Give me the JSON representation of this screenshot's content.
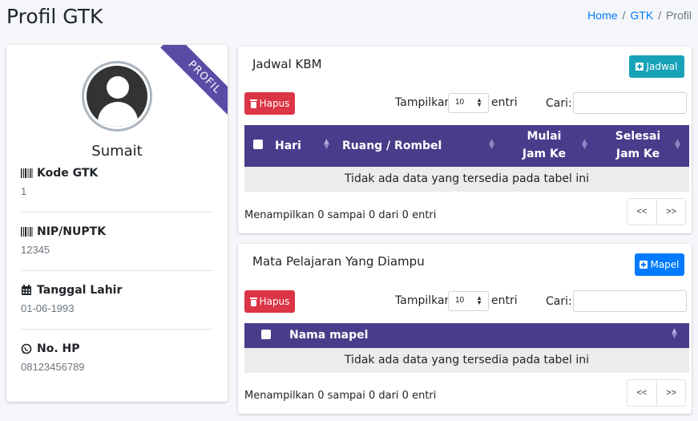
{
  "page": {
    "title": "Profil GTK",
    "breadcrumb": [
      "Home",
      "GTK",
      "Profil"
    ],
    "separator": "/"
  },
  "profile": {
    "ribbon": "PROFIL",
    "name": "Sumait",
    "fields": [
      {
        "icon": "barcode-icon",
        "label": "Kode GTK",
        "value": "1"
      },
      {
        "icon": "barcode-icon",
        "label": "NIP/NUPTK",
        "value": "12345"
      },
      {
        "icon": "calendar-icon",
        "label": "Tanggal Lahir",
        "value": "01-06-1993"
      },
      {
        "icon": "whatsapp-icon",
        "label": "No. HP",
        "value": "08123456789"
      }
    ]
  },
  "jadwal": {
    "title": "Jadwal KBM",
    "add_button": "Jadwal",
    "delete_button": "Hapus",
    "length_prefix": "Tampilkan",
    "length_value": "10",
    "length_suffix": "entri",
    "search_label": "Cari:",
    "columns": [
      "Hari",
      "Ruang / Rombel",
      "Mulai",
      "Jam Ke",
      "Selesai",
      "Jam Ke"
    ],
    "empty": "Tidak ada data yang tersedia pada tabel ini",
    "info": "Menampilkan 0 sampai 0 dari 0 entri",
    "prev": "<<",
    "next": ">>"
  },
  "mapel": {
    "title": "Mata Pelajaran Yang Diampu",
    "add_button": "Mapel",
    "delete_button": "Hapus",
    "length_prefix": "Tampilkan",
    "length_value": "10",
    "length_suffix": "entri",
    "search_label": "Cari:",
    "columns": [
      "Nama mapel"
    ],
    "empty": "Tidak ada data yang tersedia pada tabel ini",
    "info": "Menampilkan 0 sampai 0 dari 0 entri",
    "prev": "<<",
    "next": ">>"
  },
  "colors": {
    "table_header": "#483d8b",
    "ribbon": "#5b4ba6",
    "danger": "#dc3545",
    "info": "#17a2b8",
    "primary": "#007bff"
  }
}
